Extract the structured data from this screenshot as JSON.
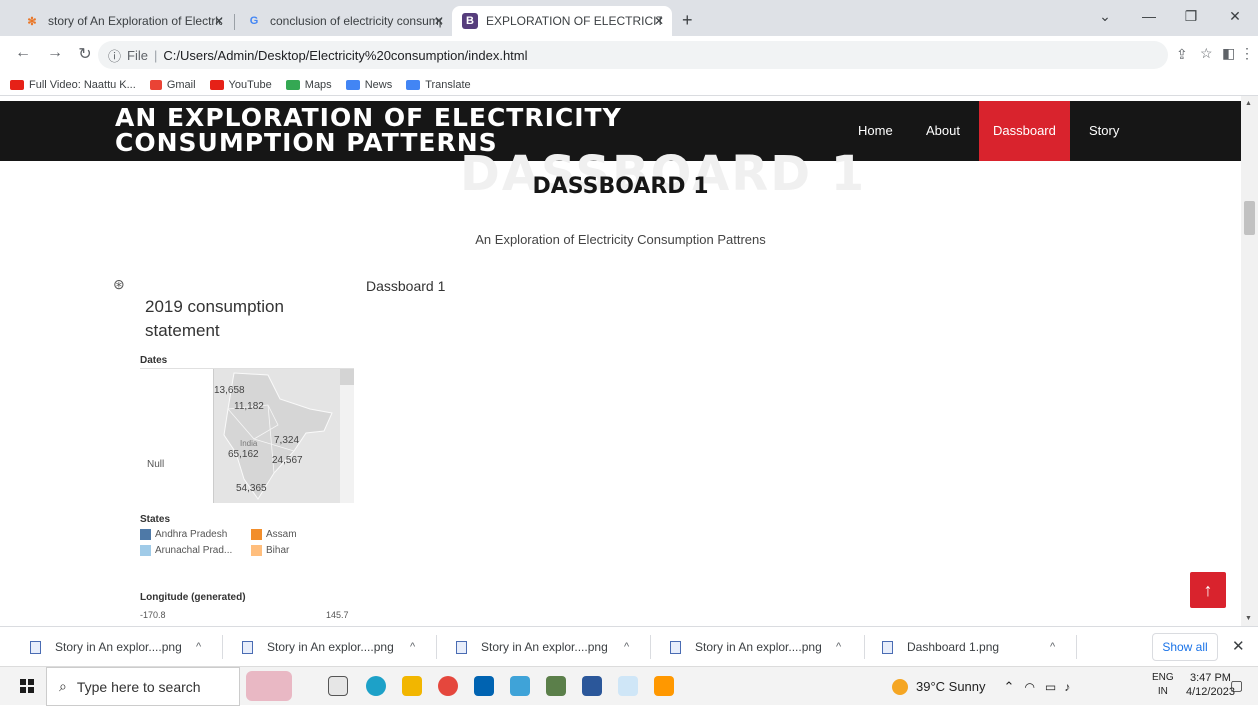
{
  "browser": {
    "tabs": [
      {
        "title": "story of An Exploration of Electric",
        "active": false
      },
      {
        "title": "conclusion of electricity consump",
        "active": false
      },
      {
        "title": "EXPLORATION OF ELECTRICITY C",
        "active": true
      }
    ],
    "new_tab": "+",
    "address": {
      "scheme": "File",
      "url": "C:/Users/Admin/Desktop/Electricity%20consumption/index.html"
    },
    "bookmarks": [
      {
        "label": "Full Video: Naattu K...",
        "color": "#e62117"
      },
      {
        "label": "Gmail",
        "color": "#ea4335"
      },
      {
        "label": "YouTube",
        "color": "#e62117"
      },
      {
        "label": "Maps",
        "color": "#34a853"
      },
      {
        "label": "News",
        "color": "#4285f4"
      },
      {
        "label": "Translate",
        "color": "#4285f4"
      }
    ]
  },
  "site": {
    "brand": "AN EXPLORATION OF ELECTRICITY CONSUMPTION PATTERNS",
    "brand_line1": "AN EXPLORATION OF ELECTRICITY",
    "brand_line2": "CONSUMPTION PATTERNS",
    "nav": [
      {
        "label": "Home",
        "active": false
      },
      {
        "label": "About",
        "active": false
      },
      {
        "label": "Dassboard",
        "active": true
      },
      {
        "label": "Story",
        "active": false
      }
    ],
    "accent_color": "#d9232d"
  },
  "section": {
    "ghost_text": "DASSBOARD 1",
    "title": "DASSBOARD 1",
    "subtitle": "An Exploration of Electricity Consumption Pattrens"
  },
  "viz": {
    "title": "2019 consumption statement",
    "side_label": "Dassboard 1",
    "dates_label": "Dates",
    "null_label": "Null",
    "map_label": "India",
    "map_values": [
      "13,658",
      "11,182",
      "7,324",
      "65,162",
      "24,567",
      "54,365"
    ],
    "states_label": "States",
    "states": [
      {
        "name": "Andhra Pradesh",
        "color": "#4e79a7"
      },
      {
        "name": "Assam",
        "color": "#f28e2b"
      },
      {
        "name": "Arunachal Prad...",
        "color": "#a0cbe8"
      },
      {
        "name": "Bihar",
        "color": "#ffbe7d"
      }
    ],
    "longitude_label": "Longitude (generated)",
    "longitude_min": "-170.8",
    "longitude_max": "145.7"
  },
  "downloads": {
    "items": [
      "Story in An explor....png",
      "Story in An explor....png",
      "Story in An explor....png",
      "Story in An explor....png",
      "Dashboard 1.png"
    ],
    "show_all": "Show all"
  },
  "taskbar": {
    "search_placeholder": "Type here to search",
    "weather": "39°C  Sunny",
    "lang": "ENG",
    "region": "IN",
    "time": "3:47 PM",
    "date": "4/12/2023"
  }
}
